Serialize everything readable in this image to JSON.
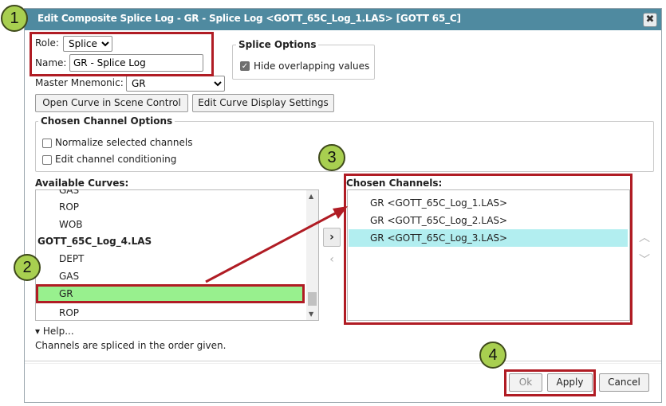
{
  "dialog": {
    "title": "Edit Composite Splice Log - GR - Splice Log <GOTT_65C_Log_1.LAS> [GOTT 65_C]",
    "close_glyph": "✖"
  },
  "role": {
    "label": "Role:",
    "value": "Splice",
    "options": [
      "Splice"
    ]
  },
  "name": {
    "label": "Name:",
    "value": "GR - Splice Log"
  },
  "splice_options": {
    "title": "Splice Options",
    "hide_overlapping_label": "Hide overlapping values",
    "hide_overlapping_checked": true
  },
  "master_mnemonic": {
    "label": "Master Mnemonic:",
    "value": "GR",
    "options": [
      "GR"
    ]
  },
  "buttons": {
    "open_curve": "Open Curve in Scene Control",
    "edit_display": "Edit Curve Display Settings",
    "ok": "Ok",
    "apply": "Apply",
    "cancel": "Cancel"
  },
  "chosen_channel_options": {
    "title": "Chosen Channel Options",
    "normalize_label": "Normalize selected channels",
    "conditioning_label": "Edit channel conditioning"
  },
  "available_curves": {
    "label": "Available Curves:",
    "items": [
      {
        "text": "GAS"
      },
      {
        "text": "ROP"
      },
      {
        "text": "WOB"
      },
      {
        "text": "GOTT_65C_Log_4.LAS"
      },
      {
        "text": "DEPT"
      },
      {
        "text": "GAS"
      },
      {
        "text": "GR"
      },
      {
        "text": "ROP"
      }
    ]
  },
  "chosen_channels": {
    "label": "Chosen Channels:",
    "items": [
      {
        "text": "GR <GOTT_65C_Log_1.LAS>"
      },
      {
        "text": "GR <GOTT_65C_Log_2.LAS>"
      },
      {
        "text": "GR <GOTT_65C_Log_3.LAS>"
      }
    ]
  },
  "move_buttons": {
    "add": "›",
    "remove": "‹",
    "up": "︿",
    "down": "﹀"
  },
  "help": {
    "toggle": "▾ Help...",
    "text": "Channels are spliced in the order given."
  },
  "callouts": [
    "1",
    "2",
    "3",
    "4"
  ],
  "colors": {
    "titlebar": "#4f8aa0",
    "highlight_red": "#b01c24",
    "callout_green": "#a8cf50",
    "selected_available": "#98f08e",
    "selected_chosen": "#b2eef0"
  }
}
